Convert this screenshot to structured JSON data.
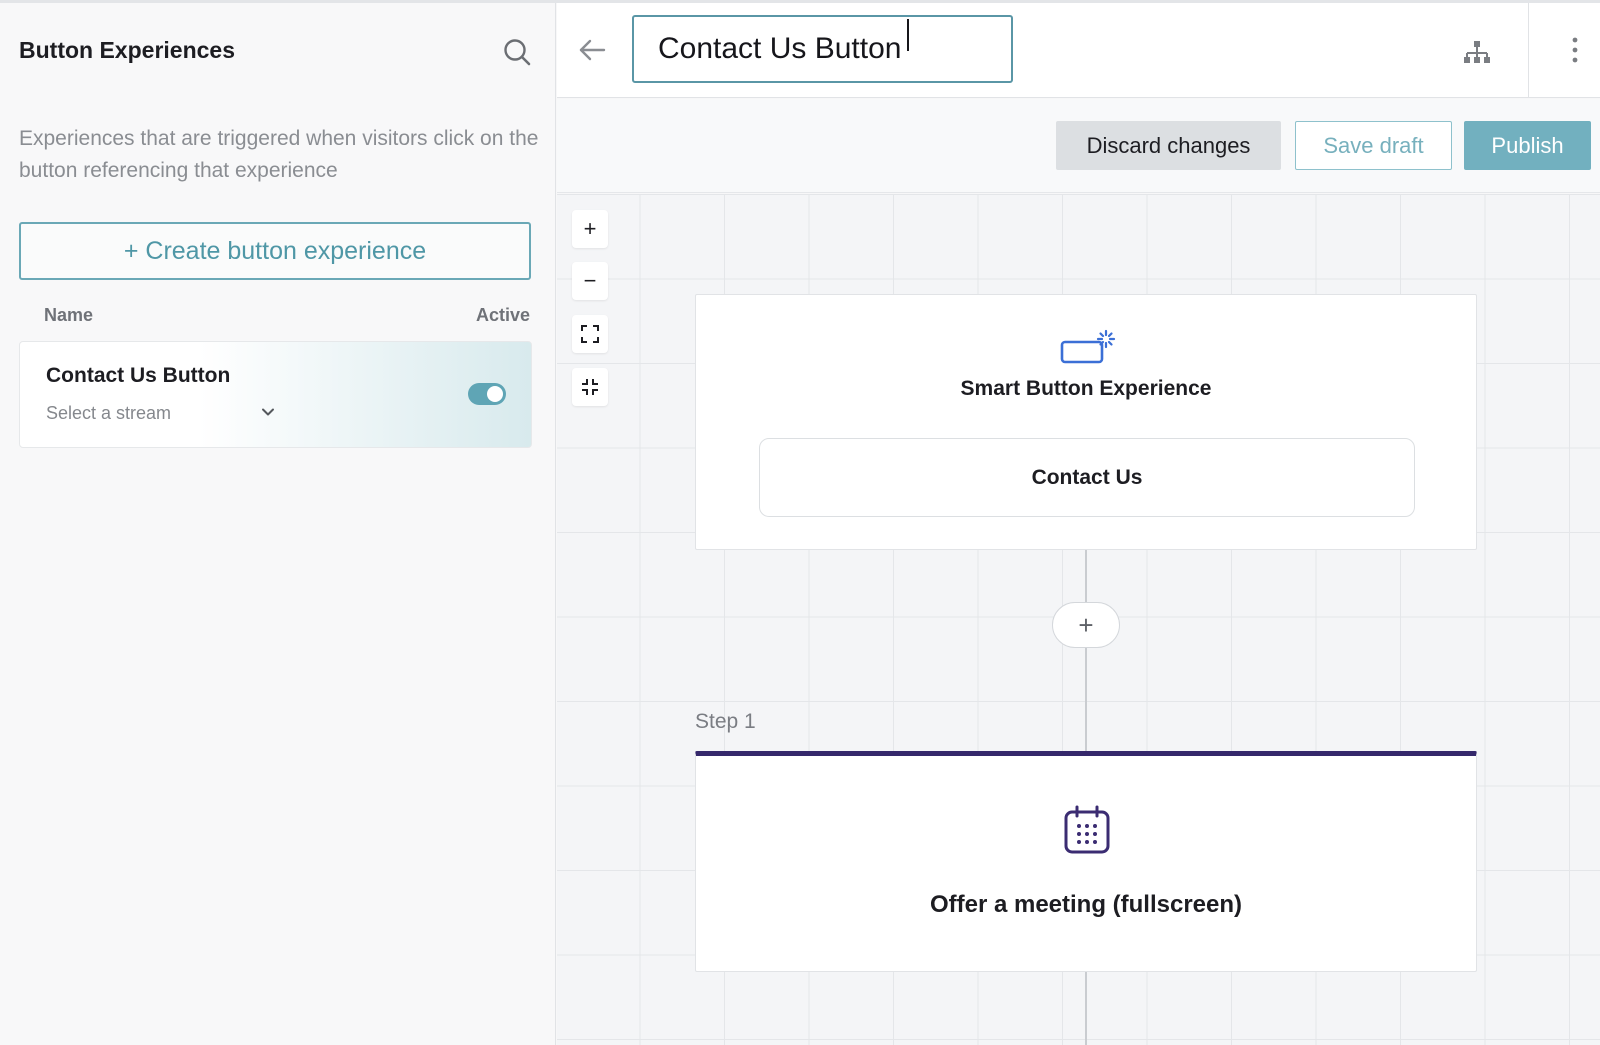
{
  "sidebar": {
    "title": "Button Experiences",
    "description": "Experiences that are triggered when visitors click on the button referencing that experience",
    "create_label": "+ Create button experience",
    "columns": {
      "name": "Name",
      "active": "Active"
    },
    "experiences": [
      {
        "name": "Contact Us Button",
        "stream_placeholder": "Select a stream",
        "active": true
      }
    ],
    "icons": {
      "search": "search-icon",
      "stream_dropdown": "chevron-down-icon"
    }
  },
  "header": {
    "title_value": "Contact Us Button",
    "icons": {
      "back": "arrow-left-icon",
      "tree": "sitemap-icon",
      "more": "more-vertical-icon"
    }
  },
  "toolbar": {
    "discard_label": "Discard changes",
    "save_label": "Save draft",
    "publish_label": "Publish"
  },
  "canvas": {
    "zoom_controls": [
      {
        "label": "+",
        "icon": "zoom-in-icon"
      },
      {
        "label": "−",
        "icon": "zoom-out-icon"
      },
      {
        "label": "",
        "icon": "expand-icon"
      },
      {
        "label": "",
        "icon": "collapse-icon"
      }
    ],
    "trigger_node": {
      "title": "Smart Button Experience",
      "button_label": "Contact Us",
      "icon": "smart-button-icon"
    },
    "add_step_label": "+",
    "steps": [
      {
        "label": "Step 1",
        "title": "Offer a meeting (fullscreen)",
        "icon": "calendar-icon"
      }
    ]
  },
  "colors": {
    "accent": "#5fa5b5",
    "publish_bg": "#72b0bf",
    "step_bar": "#35286b",
    "smart_icon": "#3b6fd6",
    "calendar_icon": "#3b2c72"
  }
}
